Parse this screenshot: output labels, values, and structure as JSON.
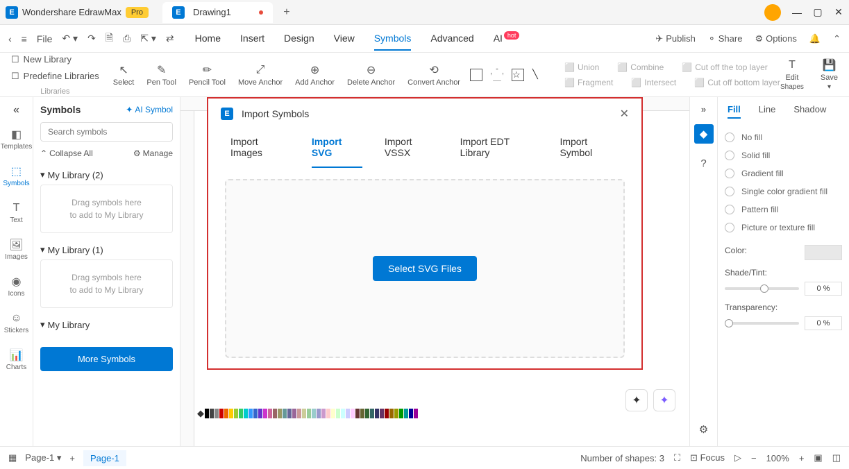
{
  "title_bar": {
    "app_name": "Wondershare EdrawMax",
    "pro": "Pro",
    "tab_name": "Drawing1"
  },
  "menu_bar": {
    "file": "File",
    "items": [
      "Home",
      "Insert",
      "Design",
      "View",
      "Symbols",
      "Advanced",
      "AI"
    ],
    "active": "Symbols",
    "hot": "hot",
    "publish": "Publish",
    "share": "Share",
    "options": "Options"
  },
  "toolbar": {
    "new_library": "New Library",
    "predefine_libraries": "Predefine Libraries",
    "libraries": "Libraries",
    "select": "Select",
    "pen_tool": "Pen Tool",
    "pencil_tool": "Pencil Tool",
    "move_anchor": "Move Anchor",
    "add_anchor": "Add Anchor",
    "delete_anchor": "Delete Anchor",
    "convert_anchor": "Convert Anchor",
    "union": "Union",
    "combine": "Combine",
    "cut_top": "Cut off the top layer",
    "fragment": "Fragment",
    "intersect": "Intersect",
    "cut_bottom": "Cut off bottom layer",
    "edit": "Edit",
    "shapes": "Shapes",
    "save": "Save"
  },
  "left_rail": {
    "templates": "Templates",
    "symbols": "Symbols",
    "text": "Text",
    "images": "Images",
    "icons": "Icons",
    "stickers": "Stickers",
    "charts": "Charts"
  },
  "sidebar": {
    "title": "Symbols",
    "ai_symbol": "AI Symbol",
    "search_placeholder": "Search symbols",
    "collapse_all": "Collapse All",
    "manage": "Manage",
    "sections": [
      {
        "title": "My Library (2)",
        "drop": "Drag symbols here\nto add to My Library"
      },
      {
        "title": "My Library (1)",
        "drop": "Drag symbols here\nto add to My Library"
      },
      {
        "title": "My Library",
        "drop": ""
      }
    ],
    "more_symbols": "More Symbols"
  },
  "dialog": {
    "title": "Import Symbols",
    "tabs": [
      "Import Images",
      "Import SVG",
      "Import VSSX",
      "Import EDT Library",
      "Import Symbol"
    ],
    "active_tab": "Import SVG",
    "button": "Select SVG Files"
  },
  "right_panel": {
    "tabs": [
      "Fill",
      "Line",
      "Shadow"
    ],
    "active_tab": "Fill",
    "options": [
      "No fill",
      "Solid fill",
      "Gradient fill",
      "Single color gradient fill",
      "Pattern fill",
      "Picture or texture fill"
    ],
    "color_label": "Color:",
    "shade_label": "Shade/Tint:",
    "shade_value": "0 %",
    "transparency_label": "Transparency:",
    "transparency_value": "0 %"
  },
  "status_bar": {
    "page_label": "Page-1",
    "page_tab": "Page-1",
    "shapes_count": "Number of shapes: 3",
    "focus": "Focus",
    "zoom": "100%"
  }
}
